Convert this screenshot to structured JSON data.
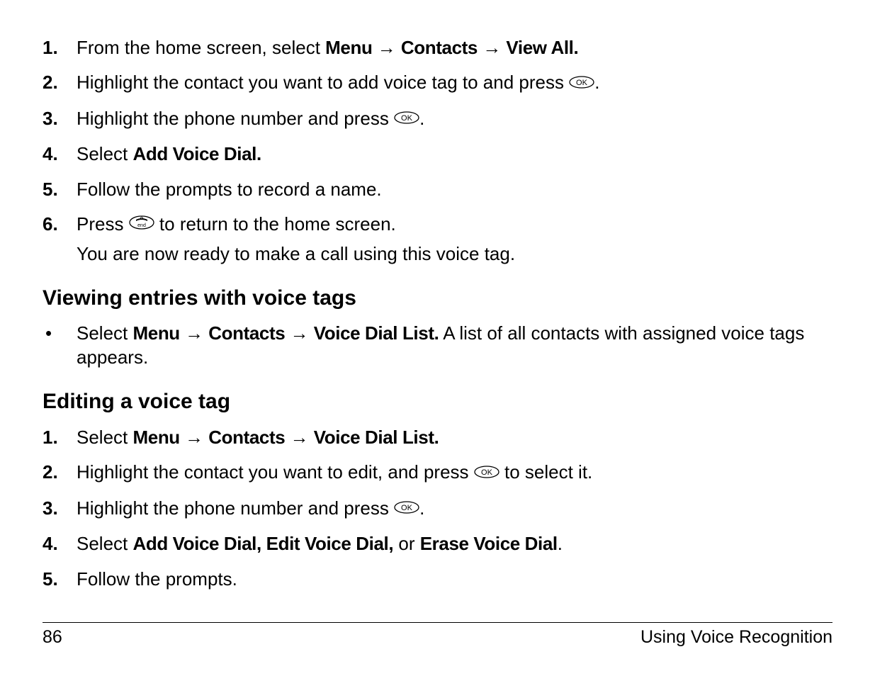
{
  "list1": {
    "items": [
      {
        "num": "1.",
        "prefix": "From the home screen, select ",
        "boldParts": [
          "Menu",
          "Contacts",
          "View All."
        ],
        "suffix": ""
      },
      {
        "num": "2.",
        "prefix": "Highlight the contact you want to add voice tag to and press ",
        "icon": "ok",
        "suffix": "."
      },
      {
        "num": "3.",
        "prefix": "Highlight the phone number and press ",
        "icon": "ok",
        "suffix": "."
      },
      {
        "num": "4.",
        "prefix": "Select ",
        "boldSingle": "Add Voice Dial.",
        "suffix": ""
      },
      {
        "num": "5.",
        "prefix": "Follow the prompts to record a name.",
        "suffix": ""
      },
      {
        "num": "6.",
        "prefix": "Press ",
        "icon": "end",
        "suffix": " to return to the home screen.",
        "continuation": "You are now ready to make a call using this voice tag."
      }
    ],
    "arrow": "→"
  },
  "heading1": "Viewing entries with voice tags",
  "bullet1": {
    "prefix": "Select ",
    "boldParts": [
      "Menu",
      "Contacts",
      "Voice Dial List."
    ],
    "suffix": " A list of all contacts with assigned voice tags appears.",
    "arrow": "→"
  },
  "heading2": "Editing a voice tag",
  "list2": {
    "items": [
      {
        "num": "1.",
        "prefix": "Select ",
        "boldParts": [
          "Menu",
          "Contacts",
          "Voice Dial List."
        ],
        "arrow": "→"
      },
      {
        "num": "2.",
        "prefix": "Highlight the contact you want to edit, and press ",
        "icon": "ok",
        "suffix": " to select it."
      },
      {
        "num": "3.",
        "prefix": "Highlight the phone number and press ",
        "icon": "ok",
        "suffix": "."
      },
      {
        "num": "4.",
        "prefix": "Select ",
        "bold1": "Add Voice Dial, Edit Voice Dial,",
        "mid": " or ",
        "bold2": "Erase Voice Dial",
        "suffix": "."
      },
      {
        "num": "5.",
        "prefix": "Follow the prompts."
      }
    ]
  },
  "footer": {
    "page": "86",
    "title": "Using Voice Recognition"
  },
  "icons": {
    "ok": "ok-icon",
    "end": "end-icon"
  }
}
